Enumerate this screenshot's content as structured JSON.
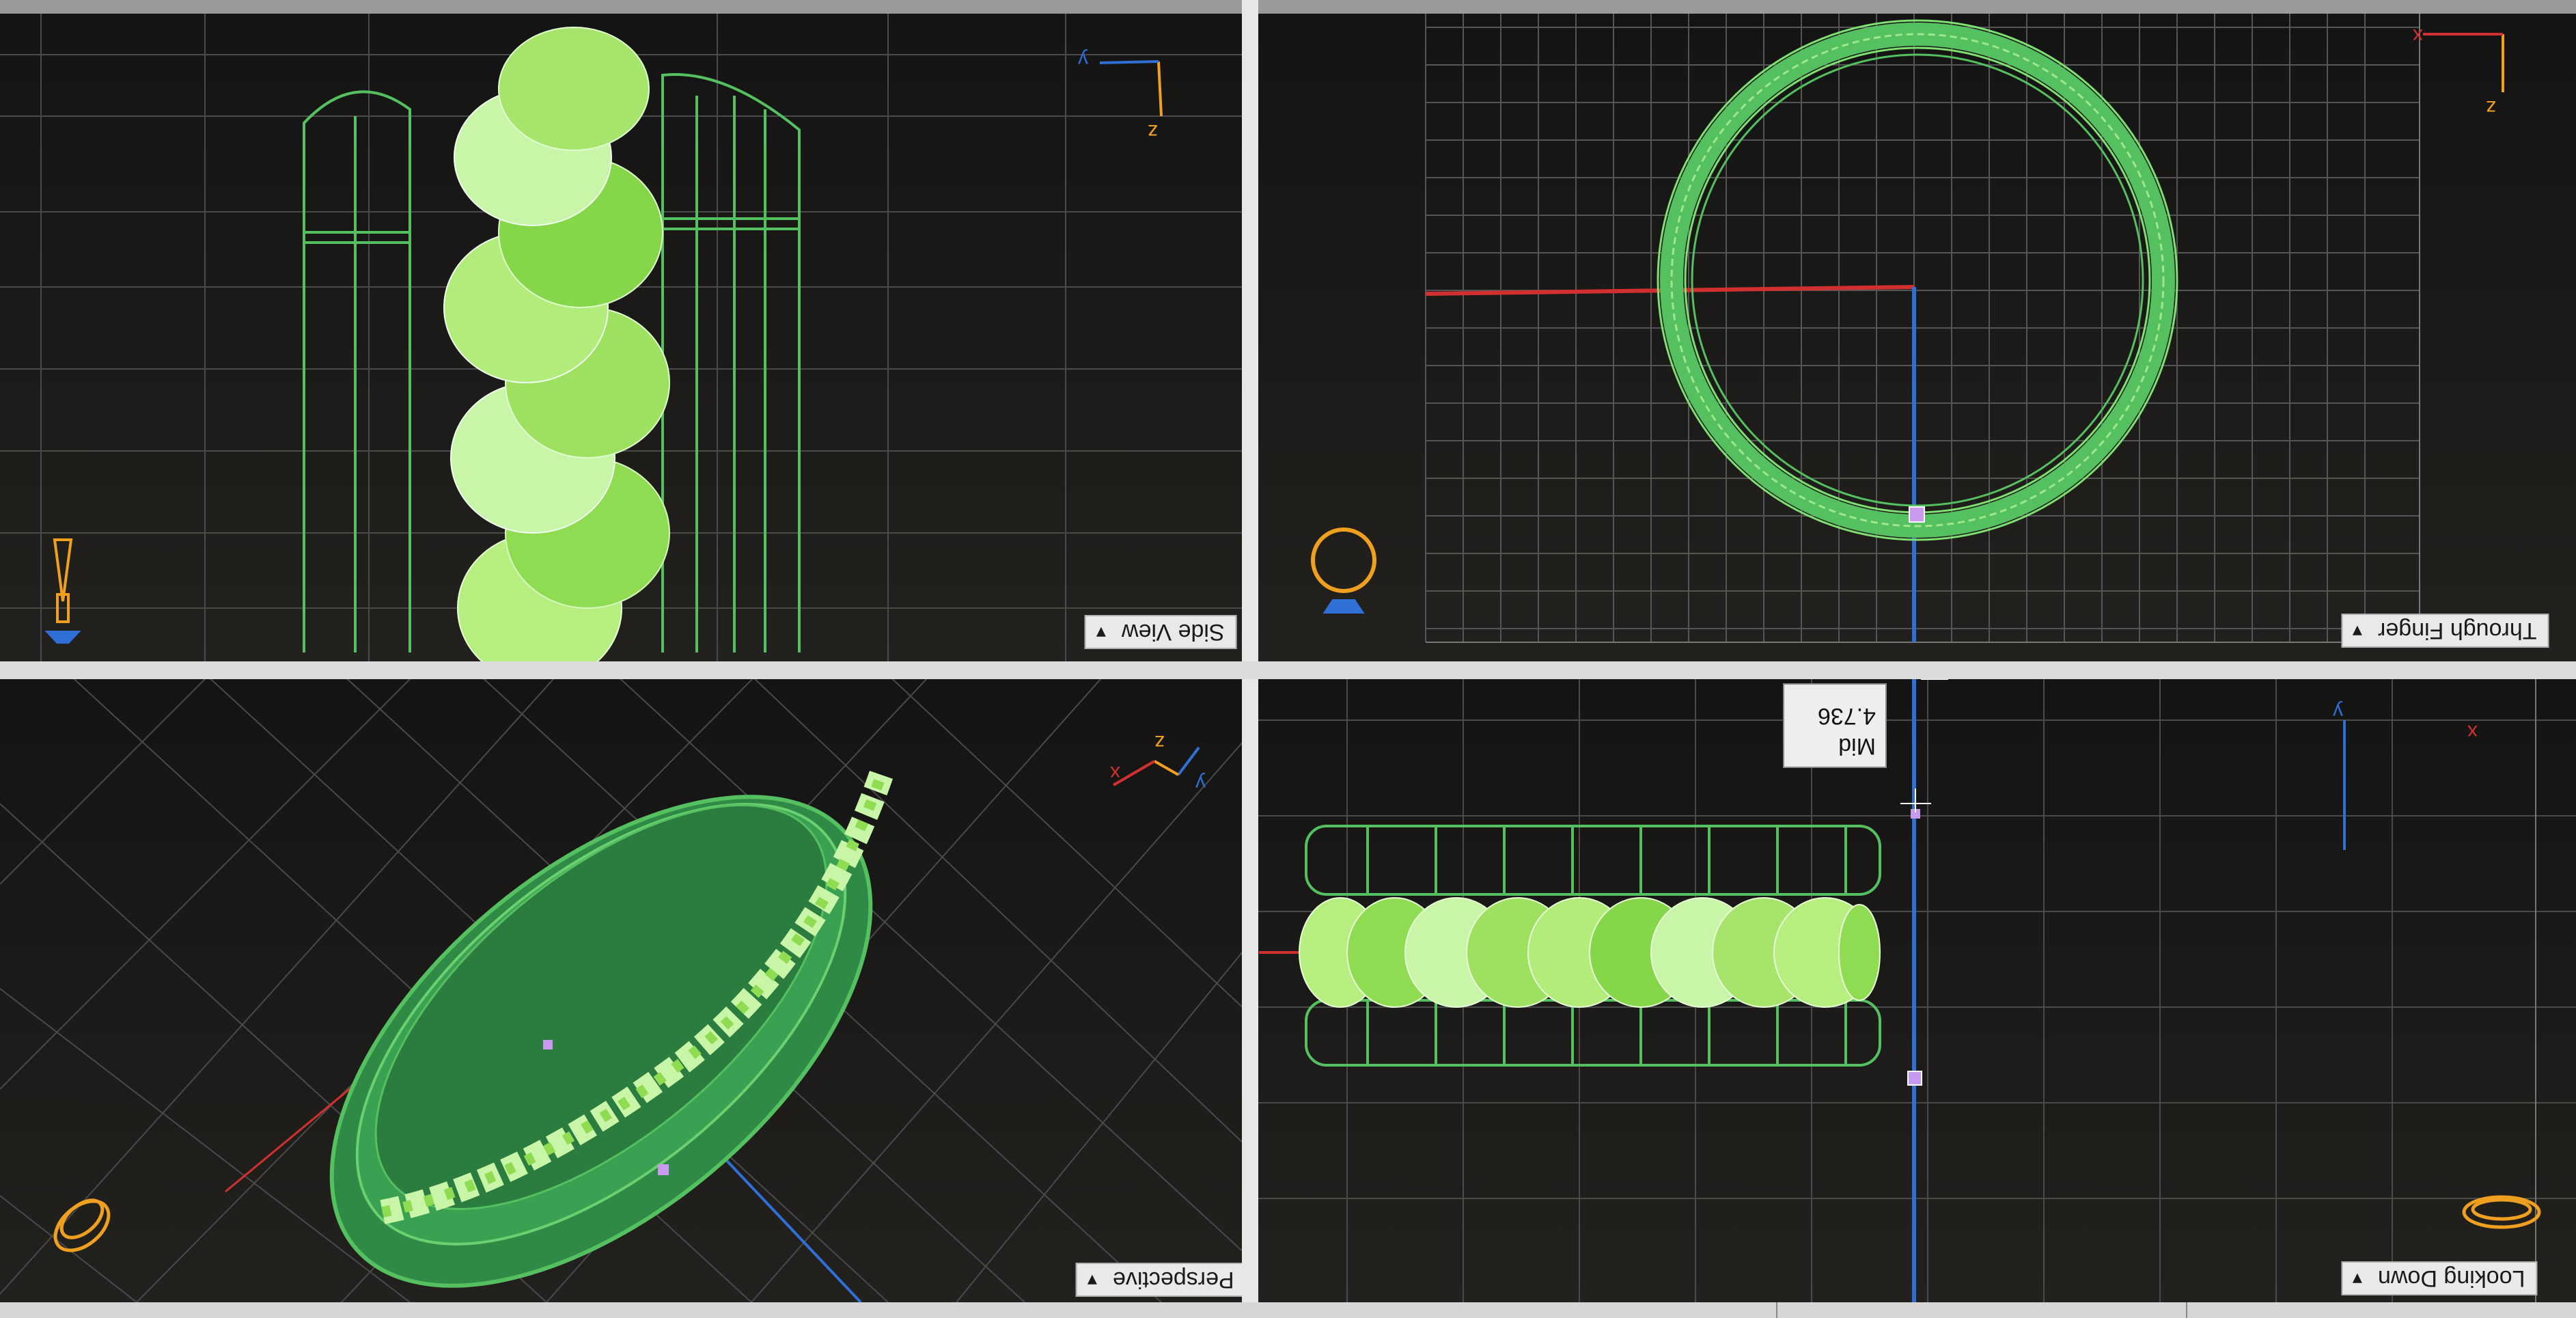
{
  "viewports": {
    "top_left": {
      "label": "Side View",
      "axes": {
        "a": "y",
        "b": "z"
      }
    },
    "top_right": {
      "label": "Through Finger",
      "axes": {
        "a": "x",
        "b": "z"
      }
    },
    "bottom_left": {
      "label": "Perspective",
      "axes": {
        "a": "y",
        "b": "z",
        "c": "x"
      }
    },
    "bottom_right": {
      "label": "Looking Down",
      "axes": {
        "a": "y",
        "b": "x"
      }
    }
  },
  "tooltip": {
    "title": "Mid",
    "value": "4.736"
  },
  "colors": {
    "grid_line": "#4a4a4a",
    "grid_major": "#5e5e5e",
    "wire_green": "#55c060",
    "braid_light": "#c8f5a8",
    "braid_mid": "#9ee060",
    "braid_dark": "#6ec84a",
    "axis_red": "#d23030",
    "axis_blue": "#2f6fd6",
    "gizmo_orange": "#f0a020",
    "label_bg": "#e9e9e9"
  },
  "icons": [
    "ring-gizmo-icon",
    "pin-gizmo-icon",
    "dropdown-arrow-icon"
  ]
}
